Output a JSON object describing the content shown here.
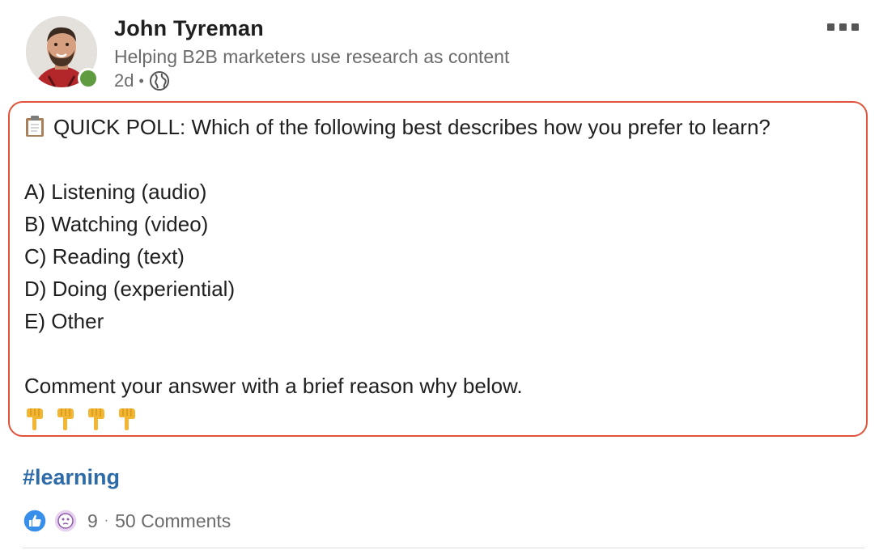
{
  "author": {
    "name": "John Tyreman",
    "headline": "Helping B2B marketers use research as content",
    "time": "2d",
    "visibility_icon": "globe-icon",
    "presence_color": "#5f9b41",
    "avatar_icon": "profile-photo"
  },
  "menu": {
    "icon": "more-options-icon"
  },
  "post": {
    "border_color": "#e0533a",
    "lines": [
      "QUICK POLL: Which of the following best describes how you prefer to learn?",
      "",
      "A) Listening (audio)",
      "B) Watching (video)",
      "C) Reading (text)",
      "D) Doing (experiential)",
      "E) Other",
      "",
      "Comment your answer with a brief reason why below."
    ],
    "lead_icon": "clipboard-icon",
    "trailing_icons": [
      "pointing-down-icon",
      "pointing-down-icon",
      "pointing-down-icon",
      "pointing-down-icon"
    ]
  },
  "hashtag": {
    "text": "#learning",
    "color": "#2c6aa8"
  },
  "social": {
    "reaction_icons": [
      "like-icon",
      "curious-icon"
    ],
    "reaction_count": "9",
    "separator": "·",
    "comments": "50 Comments"
  }
}
